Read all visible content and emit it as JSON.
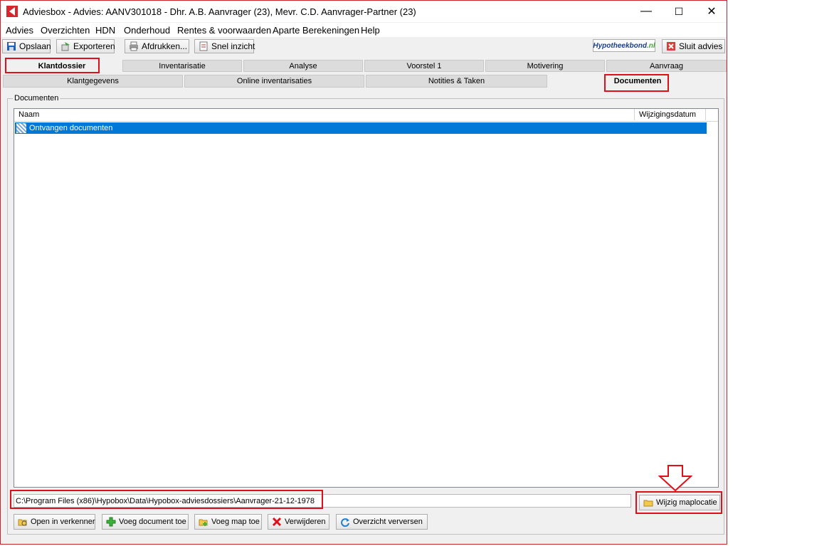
{
  "window": {
    "title": "Adviesbox - Advies: AANV301018 - Dhr. A.B. Aanvrager (23), Mevr. C.D. Aanvrager-Partner (23)",
    "minimize": "—",
    "maximize": "☐",
    "close": "✕"
  },
  "menu": [
    "Advies",
    "Overzichten",
    "HDN",
    "Onderhoud",
    "Rentes & voorwaarden",
    "Aparte Berekeningen",
    "Help"
  ],
  "toolbar": {
    "save": "Opslaan",
    "export": "Exporteren",
    "print": "Afdrukken...",
    "quick": "Snel inzicht",
    "brand": "Hypotheekbond",
    "brand_suffix": ".nl",
    "close_advice": "Sluit advies"
  },
  "tabs_main": [
    "Klantdossier",
    "Inventarisatie",
    "Analyse",
    "Voorstel 1",
    "Motivering",
    "Aanvraag"
  ],
  "tabs_sub": [
    "Klantgegevens",
    "Online inventarisaties",
    "Notities & Taken",
    "Documenten"
  ],
  "documents": {
    "group_label": "Documenten",
    "columns": [
      "Naam",
      "Wijzigingsdatum"
    ],
    "rows": [
      {
        "name": "Ontvangen documenten",
        "date": ""
      }
    ],
    "path": "C:\\Program Files (x86)\\Hypobox\\Data\\Hypobox-adviesdossiers\\Aanvrager-21-12-1978",
    "change_location": "Wijzig maplocatie"
  },
  "actions": {
    "open": "Open in verkenner",
    "add_doc": "Voeg document toe",
    "add_folder": "Voeg map toe",
    "remove": "Verwijderen",
    "refresh": "Overzicht verversen"
  },
  "colors": {
    "highlight": "#e0101a",
    "selection": "#0078d7"
  }
}
